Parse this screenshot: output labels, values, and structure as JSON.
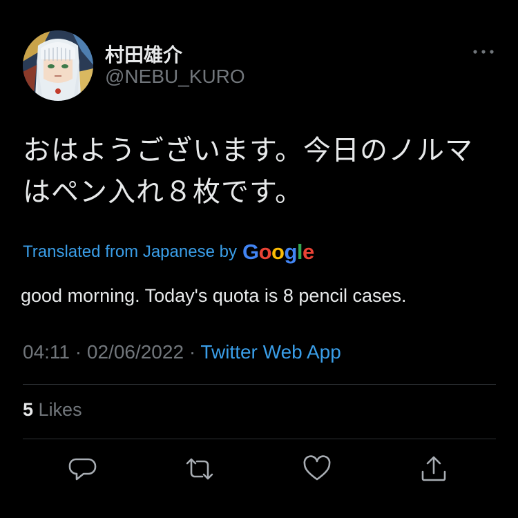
{
  "author": {
    "display_name": "村田雄介",
    "handle": "@NEBU_KURO"
  },
  "tweet": {
    "text": "おはようございます。今日のノルマはペン入れ８枚です。"
  },
  "translation": {
    "label": "Translated from Japanese by",
    "provider": {
      "letters": [
        "G",
        "o",
        "o",
        "g",
        "l",
        "e"
      ],
      "colors": [
        "#4285f4",
        "#ea4335",
        "#fbbc05",
        "#4285f4",
        "#34a853",
        "#ea4335"
      ]
    },
    "text": "good morning. Today's quota is 8 pencil cases."
  },
  "meta": {
    "time": "04:11",
    "separator": "·",
    "date": "02/06/2022",
    "source": "Twitter Web App"
  },
  "stats": {
    "likes_count": "5",
    "likes_label": "Likes"
  },
  "actions": [
    {
      "name": "reply",
      "icon": "reply-icon"
    },
    {
      "name": "retweet",
      "icon": "retweet-icon"
    },
    {
      "name": "like",
      "icon": "heart-icon"
    },
    {
      "name": "share",
      "icon": "share-icon"
    }
  ],
  "colors": {
    "background": "#000000",
    "primary_text": "#e7e9ea",
    "secondary_text": "#71767b",
    "link": "#3a9ee8",
    "divider": "#2f3336"
  }
}
